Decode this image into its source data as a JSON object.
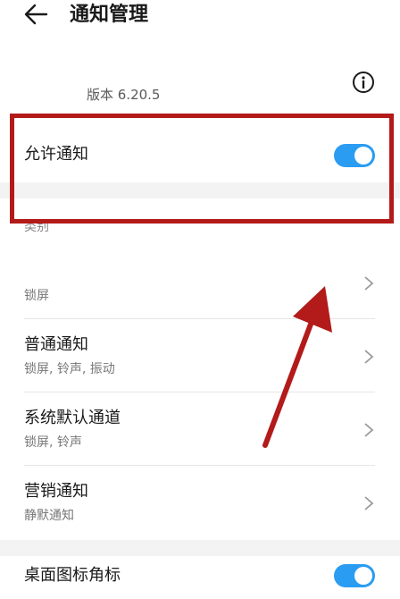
{
  "header": {
    "title": "通知管理"
  },
  "app": {
    "version": "版本 6.20.5"
  },
  "allow_notification": {
    "label": "允许通知",
    "enabled": true
  },
  "section": {
    "category_label": "类别"
  },
  "items": [
    {
      "label": "",
      "sub": "锁屏"
    },
    {
      "label": "普通通知",
      "sub": "锁屏, 铃声, 振动"
    },
    {
      "label": "系统默认通道",
      "sub": "锁屏, 铃声"
    },
    {
      "label": "营销通知",
      "sub": "静默通知"
    }
  ],
  "badge": {
    "label": "桌面图标角标",
    "enabled": true
  },
  "colors": {
    "accent": "#2a9cf2",
    "annotation": "#b31a1a"
  }
}
